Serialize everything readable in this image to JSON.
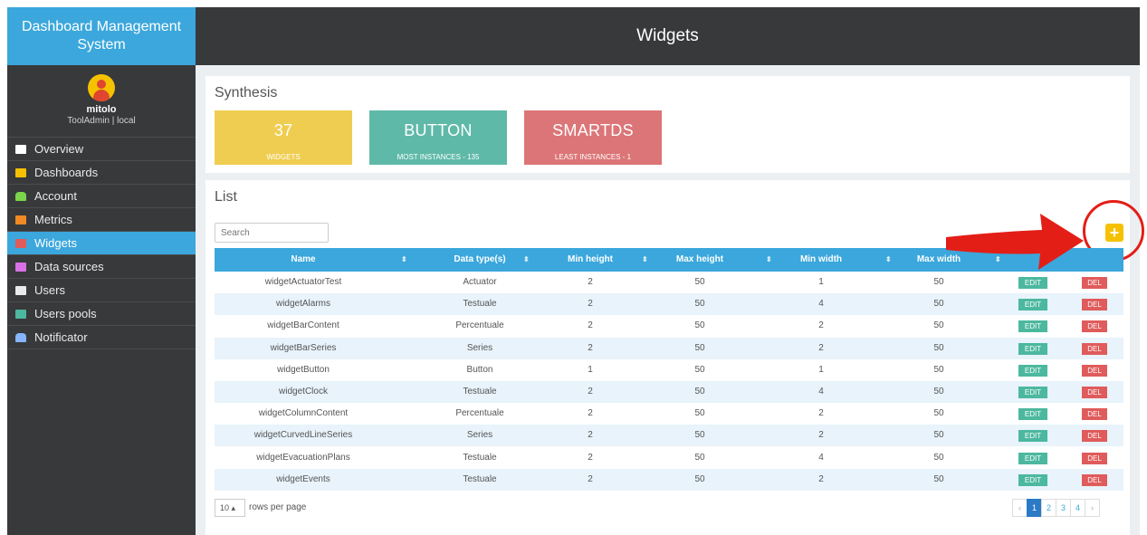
{
  "brand": "Dashboard Management System",
  "header": {
    "title": "Widgets"
  },
  "user": {
    "name": "mitolo",
    "role": "ToolAdmin | local"
  },
  "nav": [
    {
      "label": "Overview",
      "icon": "monitor-icon",
      "color": "#ffffff"
    },
    {
      "label": "Dashboards",
      "icon": "gauge-icon",
      "color": "#f6c100"
    },
    {
      "label": "Account",
      "icon": "user-icon",
      "color": "#7bd44a"
    },
    {
      "label": "Metrics",
      "icon": "metrics-icon",
      "color": "#f08a24"
    },
    {
      "label": "Widgets",
      "icon": "widgets-icon",
      "color": "#e05b5b",
      "active": true
    },
    {
      "label": "Data sources",
      "icon": "database-icon",
      "color": "#d971e6"
    },
    {
      "label": "Users",
      "icon": "users-icon",
      "color": "#e8eaeb"
    },
    {
      "label": "Users pools",
      "icon": "sitemap-icon",
      "color": "#4cb89f"
    },
    {
      "label": "Notificator",
      "icon": "bell-icon",
      "color": "#86b6ff"
    }
  ],
  "synthesis": {
    "title": "Synthesis",
    "tiles": [
      {
        "value": "37",
        "caption": "WIDGETS",
        "color": "#efcd50"
      },
      {
        "value": "BUTTON",
        "caption": "MOST INSTANCES - 135",
        "color": "#5fb9a8"
      },
      {
        "value": "SMARTDS",
        "caption": "LEAST INSTANCES - 1",
        "color": "#dc7577"
      }
    ]
  },
  "list": {
    "title": "List",
    "search_placeholder": "Search",
    "columns": [
      "Name",
      "Data type(s)",
      "Min height",
      "Max height",
      "Min width",
      "Max width"
    ],
    "edit_label": "EDIT",
    "del_label": "DEL",
    "rows": [
      [
        "widgetActuatorTest",
        "Actuator",
        "2",
        "50",
        "1",
        "50"
      ],
      [
        "widgetAlarms",
        "Testuale",
        "2",
        "50",
        "4",
        "50"
      ],
      [
        "widgetBarContent",
        "Percentuale",
        "2",
        "50",
        "2",
        "50"
      ],
      [
        "widgetBarSeries",
        "Series",
        "2",
        "50",
        "2",
        "50"
      ],
      [
        "widgetButton",
        "Button",
        "1",
        "50",
        "1",
        "50"
      ],
      [
        "widgetClock",
        "Testuale",
        "2",
        "50",
        "4",
        "50"
      ],
      [
        "widgetColumnContent",
        "Percentuale",
        "2",
        "50",
        "2",
        "50"
      ],
      [
        "widgetCurvedLineSeries",
        "Series",
        "2",
        "50",
        "2",
        "50"
      ],
      [
        "widgetEvacuationPlans",
        "Testuale",
        "2",
        "50",
        "4",
        "50"
      ],
      [
        "widgetEvents",
        "Testuale",
        "2",
        "50",
        "2",
        "50"
      ]
    ],
    "rows_per_page": "10",
    "rows_per_page_label": "rows per page",
    "pages": [
      "1",
      "2",
      "3",
      "4"
    ],
    "current_page": "1",
    "prev": "‹",
    "next": "›"
  },
  "colors": {
    "accent": "#3ba7dc",
    "sidebar": "#37393b",
    "annotation": "#e31e17"
  }
}
